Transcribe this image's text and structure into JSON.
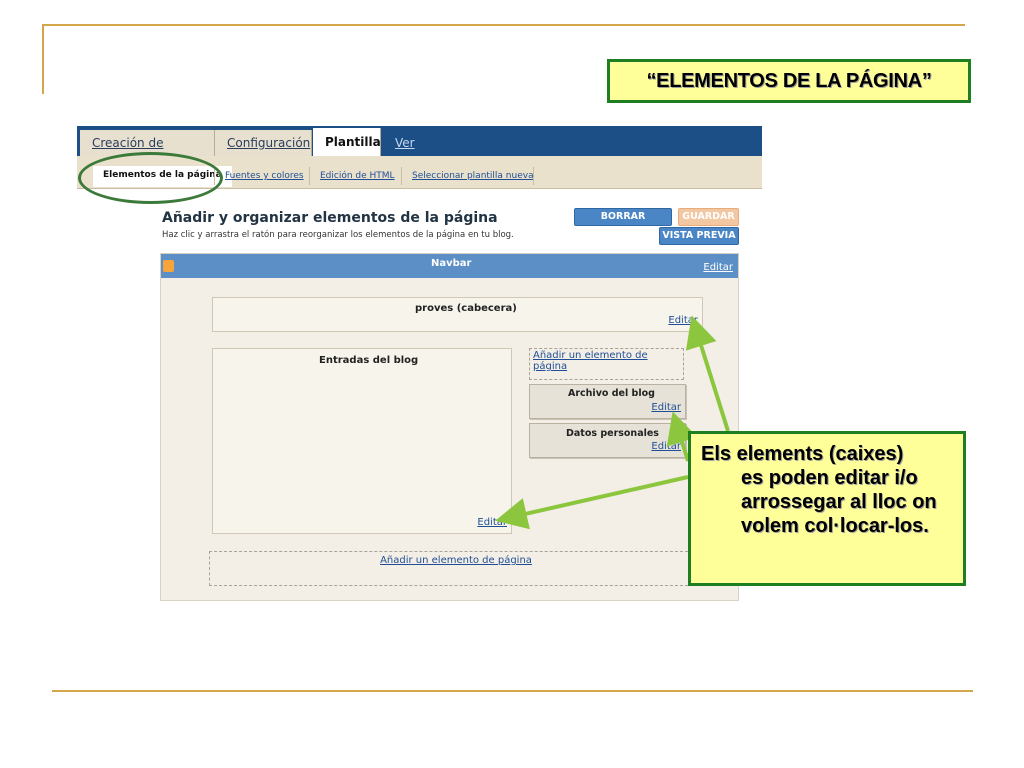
{
  "slide": {
    "title": "“ELEMENTOS DE LA PÁGINA”",
    "note_first": "Els elements (caixes)",
    "note_rest": "es poden editar i/o arrossegar al lloc on volem col·locar-los."
  },
  "tabs": [
    {
      "label": "Creación de entradas"
    },
    {
      "label": "Configuración"
    },
    {
      "label": "Plantilla"
    },
    {
      "label": "Ver blog"
    }
  ],
  "subtabs": [
    {
      "label": "Elementos de la página"
    },
    {
      "label": "Fuentes y colores"
    },
    {
      "label": "Edición de HTML"
    },
    {
      "label": "Seleccionar plantilla nueva"
    }
  ],
  "page": {
    "heading": "Añadir y organizar elementos de la página",
    "subheading": "Haz clic y arrastra el ratón para reorganizar los elementos de la página en tu blog.",
    "btn_borrar": "BORRAR CAMBIOS",
    "btn_guardar": "GUARDAR",
    "btn_vista": "VISTA PREVIA"
  },
  "layout": {
    "navbar_title": "Navbar",
    "edit_label": "Editar",
    "header_title": "proves (cabecera)",
    "posts_title": "Entradas del blog",
    "add_element": "Añadir un elemento de página",
    "archive_title": "Archivo del blog",
    "profile_title": "Datos personales"
  },
  "colors": {
    "accent_green": "#1e7f22",
    "note_bg": "#ffff99",
    "tabbar_blue": "#1d4f87",
    "arrow_green": "#8cc63e",
    "deco_gold": "#d4a64a"
  }
}
